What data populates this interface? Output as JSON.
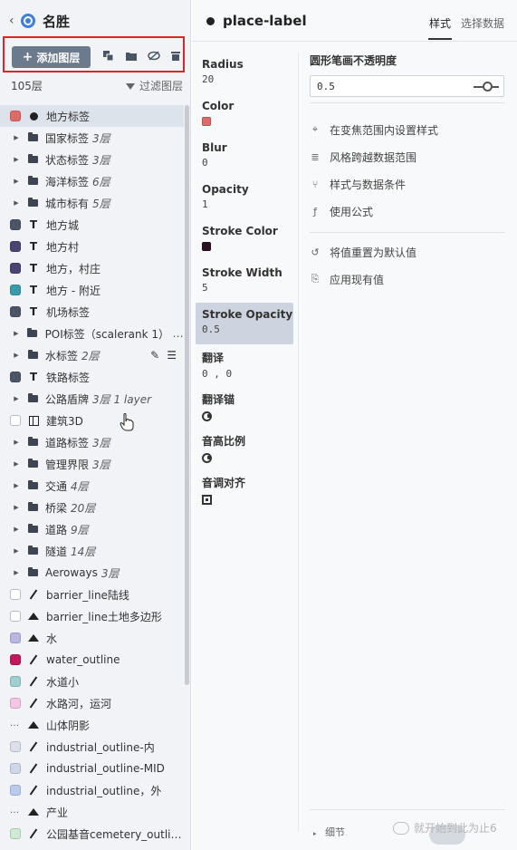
{
  "app": {
    "title": "名胜",
    "back": "‹"
  },
  "toolbar": {
    "add_layer_label": "添加图层",
    "add_plus": "+"
  },
  "layers": {
    "count_label": "105层",
    "filter_label": "过滤图层"
  },
  "layer_list": [
    {
      "label": "地方标签",
      "icon": "dot",
      "swatch": "#e06a6a",
      "selected": true
    },
    {
      "label": "国家标签",
      "icon": "folder",
      "count": "3层"
    },
    {
      "label": "状态标签",
      "icon": "folder",
      "count": "3层"
    },
    {
      "label": "海洋标签",
      "icon": "folder",
      "count": "6层"
    },
    {
      "label": "城市标有",
      "icon": "folder",
      "count": "5层"
    },
    {
      "label": "地方城",
      "icon": "text",
      "swatch": "#4c5568"
    },
    {
      "label": "地方村",
      "icon": "text",
      "swatch": "#4a4472"
    },
    {
      "label": "地方，村庄",
      "icon": "text",
      "swatch": "#4a4472"
    },
    {
      "label": "地方 - 附近",
      "icon": "text",
      "swatch": "#3a9aa8"
    },
    {
      "label": "机场标签",
      "icon": "text",
      "swatch": "#4c5568"
    },
    {
      "label": "POI标签（scalerank 1）",
      "icon": "folder",
      "count": "…"
    },
    {
      "label": "水标签",
      "icon": "folder",
      "count": "2层",
      "tools": true
    },
    {
      "label": "铁路标签",
      "icon": "text",
      "swatch": "#4c5568"
    },
    {
      "label": "公路盾牌",
      "icon": "folder",
      "count": "3层 1 layer"
    },
    {
      "label": "建筑3D",
      "icon": "cube",
      "swatch": "empty"
    },
    {
      "label": "道路标签",
      "icon": "folder",
      "count": "3层"
    },
    {
      "label": "管理界限",
      "icon": "folder",
      "count": "3层"
    },
    {
      "label": "交通",
      "icon": "folder",
      "count": "4层"
    },
    {
      "label": "桥梁",
      "icon": "folder",
      "count": "20层"
    },
    {
      "label": "道路",
      "icon": "folder",
      "count": "9层"
    },
    {
      "label": "隧道",
      "icon": "folder",
      "count": "14层"
    },
    {
      "label": "Aeroways",
      "icon": "folder",
      "count": "3层"
    },
    {
      "label": "barrier_line陆线",
      "icon": "pencil",
      "swatch": "empty"
    },
    {
      "label": "barrier_line土地多边形",
      "icon": "mount",
      "swatch": "empty"
    },
    {
      "label": "水",
      "icon": "mount",
      "swatch": "#b9b6e0"
    },
    {
      "label": "water_outline",
      "icon": "pencil",
      "swatch": "#c2185b"
    },
    {
      "label": "水道小",
      "icon": "pencil",
      "swatch": "#9fd0cf"
    },
    {
      "label": "水路河，运河",
      "icon": "pencil",
      "swatch": "#f3c6e3"
    },
    {
      "label": "山体阴影",
      "icon": "mount",
      "swatch": "dots"
    },
    {
      "label": "industrial_outline-内",
      "icon": "pencil",
      "swatch": "#dde0ea"
    },
    {
      "label": "industrial_outline-MID",
      "icon": "pencil",
      "swatch": "#cfd8ea"
    },
    {
      "label": "industrial_outline，外",
      "icon": "pencil",
      "swatch": "#b9cbea"
    },
    {
      "label": "产业",
      "icon": "mount",
      "swatch": "dots"
    },
    {
      "label": "公园基音cemetery_outli…",
      "icon": "pencil",
      "swatch": "#cdebd3"
    }
  ],
  "layer_editor": {
    "layer_name": "place-label",
    "tabs": [
      "样式",
      "选择数据"
    ],
    "properties": [
      {
        "label": "Radius",
        "value": "20",
        "type": "text"
      },
      {
        "label": "Color",
        "value": "",
        "type": "color",
        "color": "#e06a6a"
      },
      {
        "label": "Blur",
        "value": "0",
        "type": "text"
      },
      {
        "label": "Opacity",
        "value": "1",
        "type": "text"
      },
      {
        "label": "Stroke Color",
        "value": "",
        "type": "color",
        "color": "#2a1020"
      },
      {
        "label": "Stroke Width",
        "value": "5",
        "type": "text"
      },
      {
        "label": "Stroke Opacity",
        "value": "0.5",
        "type": "text",
        "active": true
      },
      {
        "label": "翻译",
        "value": "0 , 0",
        "type": "text"
      },
      {
        "label": "翻译锚",
        "value": "",
        "type": "circ"
      },
      {
        "label": "音高比例",
        "value": "",
        "type": "circ"
      },
      {
        "label": "音调对齐",
        "value": "",
        "type": "target"
      }
    ],
    "editor_title": "圆形笔画不透明度",
    "editor_value": "0.5",
    "actions": [
      {
        "label": "在变焦范围内设置样式",
        "icon": "⌖"
      },
      {
        "label": "风格跨越数据范围",
        "icon": "≣"
      },
      {
        "label": "样式与数据条件",
        "icon": "⑂"
      },
      {
        "label": "使用公式",
        "icon": "ƒ"
      }
    ],
    "actions2": [
      {
        "label": "将值重置为默认值",
        "icon": "↺"
      },
      {
        "label": "应用现有值",
        "icon": "⎘"
      }
    ],
    "details_label": "细节",
    "details_tri": "▸"
  },
  "watermark": "就开始到此为止6",
  "colors": {
    "accent": "#d9262b",
    "button": "#6b7a8d"
  }
}
